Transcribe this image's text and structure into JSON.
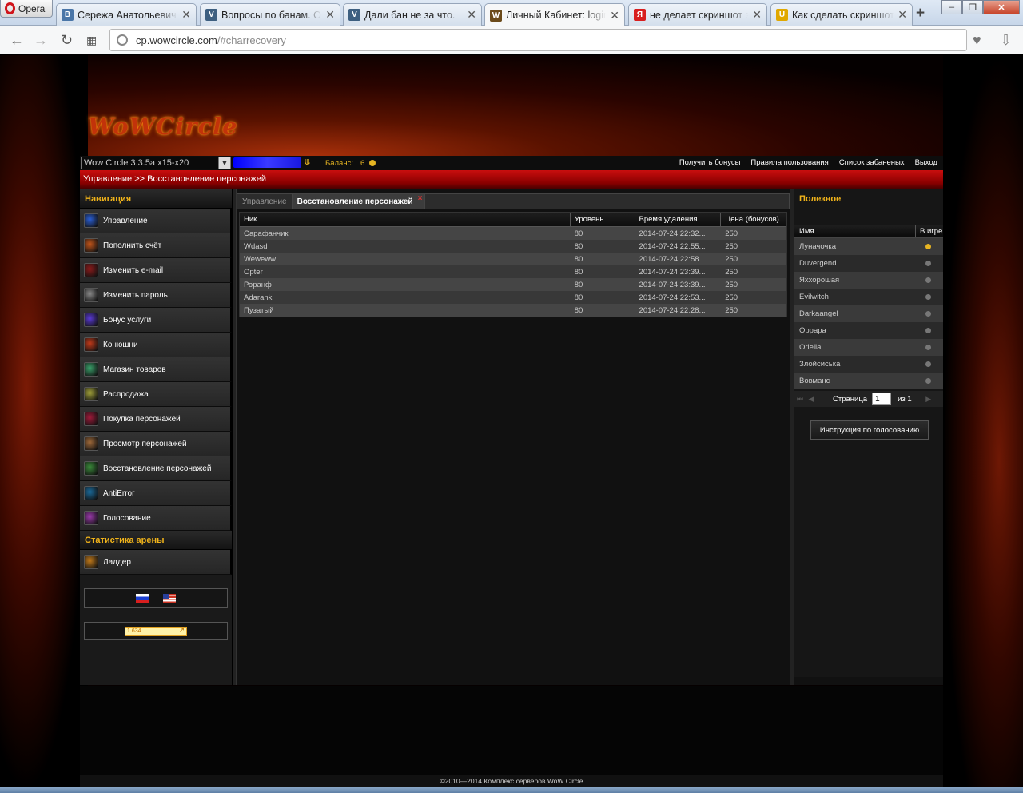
{
  "browser": {
    "opera_label": "Opera",
    "tabs": [
      {
        "title": "Сережа Анатольевич",
        "icon": "vk-icon",
        "color": "#4a76a8",
        "glyph": "B"
      },
      {
        "title": "Вопросы по банам. Об",
        "icon": "forum-icon",
        "color": "#3d5f80",
        "glyph": "V"
      },
      {
        "title": "Дали бан не за что.",
        "icon": "forum-icon",
        "color": "#3d5f80",
        "glyph": "V"
      },
      {
        "title": "Личный Кабинет: login",
        "icon": "wow-icon",
        "color": "#6b4a1a",
        "glyph": "W"
      },
      {
        "title": "не делает скриншот эк",
        "icon": "yandex-icon",
        "color": "#d81e1e",
        "glyph": "Я"
      },
      {
        "title": "Как сделать скриншот",
        "icon": "shield-icon",
        "color": "#e0a800",
        "glyph": "U"
      }
    ],
    "url_host": "cp.wowcircle.com",
    "url_path": "/#charrecovery"
  },
  "site": {
    "logo_text": "WoWCircle",
    "realm_select": "Wow Circle 3.3.5a x15-x20",
    "balance_label": "Баланс:",
    "balance_value": "6",
    "top_links": [
      "Получить бонусы",
      "Правила пользования",
      "Список забаненых",
      "Выход"
    ],
    "breadcrumb": "Управление >> Восстановление персонажей"
  },
  "nav": {
    "title": "Навигация",
    "items": [
      {
        "label": "Управление",
        "color": "#2a5fd6"
      },
      {
        "label": "Пополнить счёт",
        "color": "#c2551a"
      },
      {
        "label": "Изменить e-mail",
        "color": "#8a1a1a"
      },
      {
        "label": "Изменить пароль",
        "color": "#8a8a8a"
      },
      {
        "label": "Бонус услуги",
        "color": "#5a3ad6"
      },
      {
        "label": "Конюшни",
        "color": "#c23a1a"
      },
      {
        "label": "Магазин товаров",
        "color": "#3aa06a"
      },
      {
        "label": "Распродажа",
        "color": "#a0a03a"
      },
      {
        "label": "Покупка персонажей",
        "color": "#a01a3a"
      },
      {
        "label": "Просмотр персонажей",
        "color": "#a06a3a"
      },
      {
        "label": "Восстановление персонажей",
        "color": "#3a8a3a"
      },
      {
        "label": "AntiError",
        "color": "#1a6a9a"
      },
      {
        "label": "Голосование",
        "color": "#9a3aaa"
      }
    ],
    "arena_title": "Статистика арены",
    "arena_items": [
      {
        "label": "Ладдер",
        "color": "#c27a1a"
      }
    ],
    "counter_value": "1 634"
  },
  "panel": {
    "tabs": [
      "Управление",
      "Восстановление персонажей"
    ],
    "columns": [
      "Ник",
      "Уровень",
      "Время удаления",
      "Цена (бонусов)"
    ],
    "rows": [
      [
        "Сарафанчик",
        "80",
        "2014-07-24 22:32...",
        "250"
      ],
      [
        "Wdasd",
        "80",
        "2014-07-24 22:55...",
        "250"
      ],
      [
        "Weweww",
        "80",
        "2014-07-24 22:58...",
        "250"
      ],
      [
        "Opter",
        "80",
        "2014-07-24 23:39...",
        "250"
      ],
      [
        "Роранф",
        "80",
        "2014-07-24 23:39...",
        "250"
      ],
      [
        "Adarank",
        "80",
        "2014-07-24 22:53...",
        "250"
      ],
      [
        "Пузатый",
        "80",
        "2014-07-24 22:28...",
        "250"
      ]
    ]
  },
  "useful": {
    "title": "Полезное",
    "columns": [
      "Имя",
      "В игре"
    ],
    "rows": [
      {
        "name": "Луначочка",
        "online": true
      },
      {
        "name": "Duvergend",
        "online": false
      },
      {
        "name": "Яххорошая",
        "online": false
      },
      {
        "name": "Evilwitch",
        "online": false
      },
      {
        "name": "Darkaangel",
        "online": false
      },
      {
        "name": "Oppapa",
        "online": false
      },
      {
        "name": "Oriella",
        "online": false
      },
      {
        "name": "Злойсиська",
        "online": false
      },
      {
        "name": "Вовманс",
        "online": false
      }
    ],
    "pager_label": "Страница",
    "pager_value": "1",
    "pager_of": "из 1",
    "vote_button": "Инструкция по голосованию"
  },
  "footer": "©2010—2014 Комплекс серверов WoW Circle"
}
